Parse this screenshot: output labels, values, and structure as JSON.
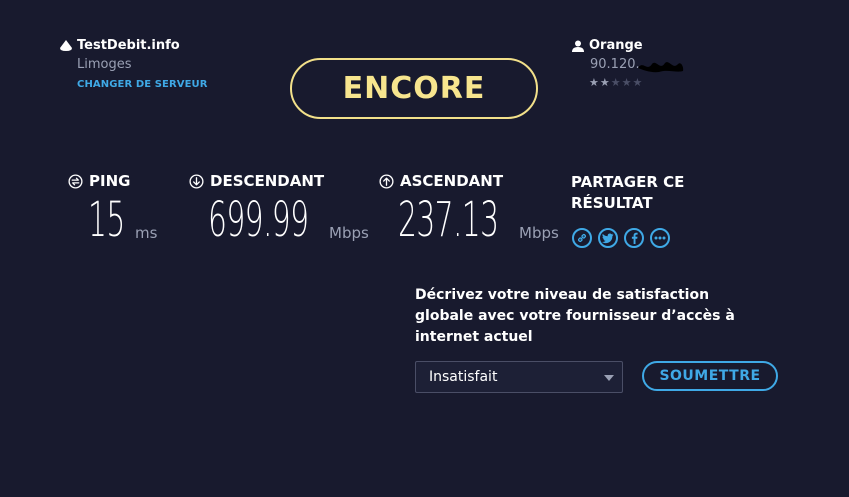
{
  "server": {
    "name": "TestDebit.info",
    "city": "Limoges",
    "change_label": "CHANGER DE SERVEUR"
  },
  "isp": {
    "name": "Orange",
    "ip_partial": "90.120.",
    "rating": 2,
    "rating_max": 5
  },
  "encore_label": "ENCORE",
  "metrics": {
    "ping": {
      "label": "PING",
      "value": "15",
      "unit": "ms"
    },
    "download": {
      "label": "DESCENDANT",
      "value": "699.99",
      "unit": "Mbps"
    },
    "upload": {
      "label": "ASCENDANT",
      "value": "237.13",
      "unit": "Mbps"
    }
  },
  "share": {
    "title": "PARTAGER CE RÉSULTAT",
    "icons": [
      "link-icon",
      "twitter-icon",
      "facebook-icon",
      "more-icon"
    ]
  },
  "survey": {
    "question": "Décrivez votre niveau de satisfaction globale avec votre fournisseur d’accès à internet actuel",
    "selected": "Insatisfait",
    "submit_label": "SOUMETTRE"
  },
  "colors": {
    "background": "#181a2e",
    "accent_yellow": "#f7e58e",
    "accent_blue": "#3fa9e6",
    "muted_text": "#9aa0b4"
  }
}
